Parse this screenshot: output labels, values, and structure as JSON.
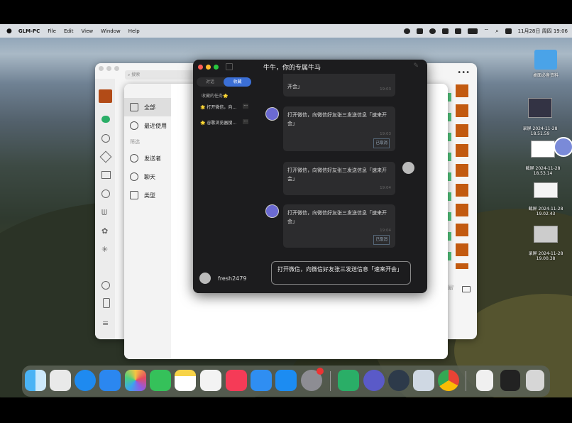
{
  "menubar": {
    "app_name": "GLM-PC",
    "items": [
      "File",
      "Edit",
      "View",
      "Window",
      "Help"
    ],
    "clock": "11月28日 周四 19:06"
  },
  "desktop": {
    "items": [
      {
        "label": "桌面必备资料",
        "icon": "folder-icon"
      },
      {
        "label": "录屏 2024-11-28\n18.51.59"
      },
      {
        "label": "截屏 2024-11-28\n18.53.14"
      },
      {
        "label": "截屏 2024-11-28\n19.02.43"
      },
      {
        "label": "录屏 2024-11-28\n19.00.38"
      }
    ]
  },
  "wechat": {
    "search_placeholder": "搜索"
  },
  "favorites": {
    "nav": [
      {
        "label": "全部",
        "icon": "folder-icon"
      },
      {
        "label": "最近使用",
        "icon": "clock-icon"
      }
    ],
    "filter_title": "筛选",
    "filters": [
      {
        "label": "发送者",
        "icon": "person-icon"
      },
      {
        "label": "聊天",
        "icon": "chat-icon"
      },
      {
        "label": "类型",
        "icon": "doc-icon"
      }
    ]
  },
  "glm": {
    "title": "牛牛，你的专属牛马",
    "tabs": [
      "对话",
      "收藏"
    ],
    "active_tab": "收藏",
    "section_title": "收藏的任务🌟",
    "tasks": [
      "🌟 打开微信，向...",
      "🌟 谷歌浏览器搜..."
    ],
    "username": "fresh2479",
    "messages": [
      {
        "side": "left-partial",
        "text": "开会」",
        "time": "19:03"
      },
      {
        "side": "left",
        "text": "打开微信，向微信好友张三发送信息「速来开会」",
        "time": "19:03",
        "status": "已取消"
      },
      {
        "side": "right",
        "text": "打开微信，向微信好友张三发送信息「速来开会」",
        "time": "19:04"
      },
      {
        "side": "left",
        "text": "打开微信，向微信好友张三发送信息「速来开会」",
        "time": "19:04",
        "status": "已取消"
      }
    ],
    "input_text": "打开微信，向微信好友张三发送信息「速来开会」"
  },
  "colors": {
    "glm_bg": "#1c1c1e",
    "accent": "#3b6fd6",
    "wechat_green": "#2aae67"
  }
}
